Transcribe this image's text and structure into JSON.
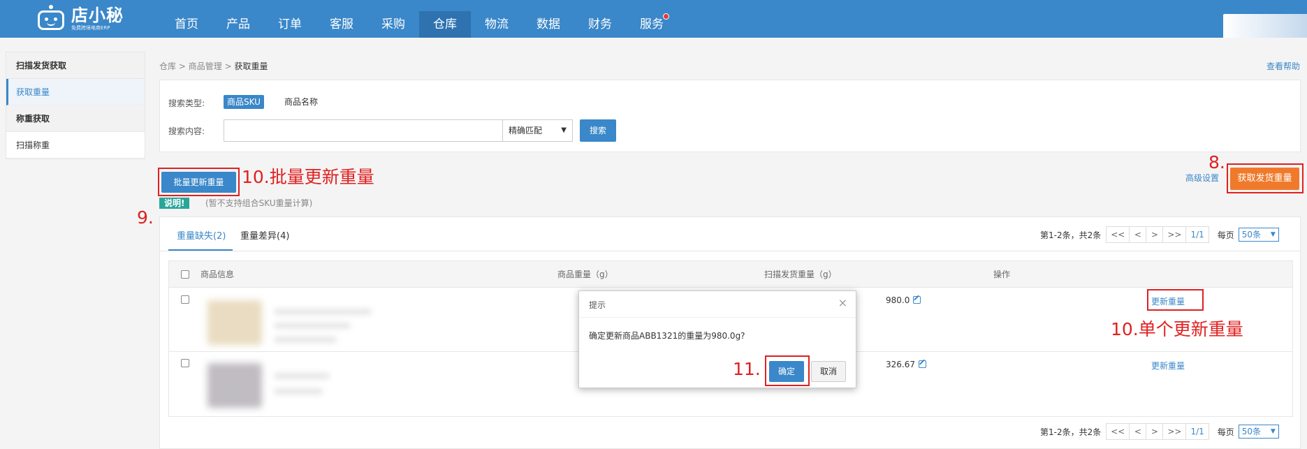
{
  "app": {
    "logo_text": "店小秘",
    "logo_sub": "免费跨境电商ERP"
  },
  "nav": {
    "items": [
      "首页",
      "产品",
      "订单",
      "客服",
      "采购",
      "仓库",
      "物流",
      "数据",
      "财务",
      "服务"
    ],
    "active": "仓库"
  },
  "sidebar": {
    "group1": "扫描发货获取",
    "item1": "获取重量",
    "group2": "称重获取",
    "item2": "扫描称重"
  },
  "breadcrumb": {
    "part1": "仓库",
    "sep": ">",
    "part2": "商品管理",
    "current": "获取重量"
  },
  "help_link": "查看帮助",
  "search": {
    "type_label": "搜索类型:",
    "type_selected": "商品SKU",
    "type_other": "商品名称",
    "content_label": "搜索内容:",
    "input_value": "",
    "match_select": "精确匹配",
    "search_button": "搜索"
  },
  "actions": {
    "batch_update": "批量更新重量",
    "advanced_settings": "高级设置",
    "get_weight": "获取发货重量"
  },
  "note": {
    "tag": "说明!",
    "text": "(暂不支持组合SKU重量计算)"
  },
  "tabs": {
    "missing": "重量缺失(2)",
    "diff": "重量差异(4)"
  },
  "pager": {
    "summary": "第1-2条，共2条",
    "first": "<<",
    "prev": "<",
    "next": ">",
    "last": ">>",
    "page": "1/1",
    "per_page_label": "每页",
    "per_page": "50条"
  },
  "table": {
    "headers": {
      "info": "商品信息",
      "weight": "商品重量（g）",
      "scan_weight": "扫描发货重量（g）",
      "ops": "操作"
    },
    "rows": [
      {
        "scan_weight": "980.0",
        "op": "更新重量"
      },
      {
        "scan_weight": "326.67",
        "op": "更新重量"
      }
    ]
  },
  "dialog": {
    "title": "提示",
    "close": "×",
    "message": "确定更新商品ABB1321的重量为980.0g?",
    "ok": "确定",
    "cancel": "取消"
  },
  "annotations": {
    "batch": "10.批量更新重量",
    "get": "8.",
    "tabs": "9.",
    "single": "10.单个更新重量",
    "confirm": "11."
  },
  "colors": {
    "primary": "#3a87c9",
    "orange": "#f07a2c",
    "annotation_red": "#e02020",
    "note_teal": "#2aa59a"
  }
}
